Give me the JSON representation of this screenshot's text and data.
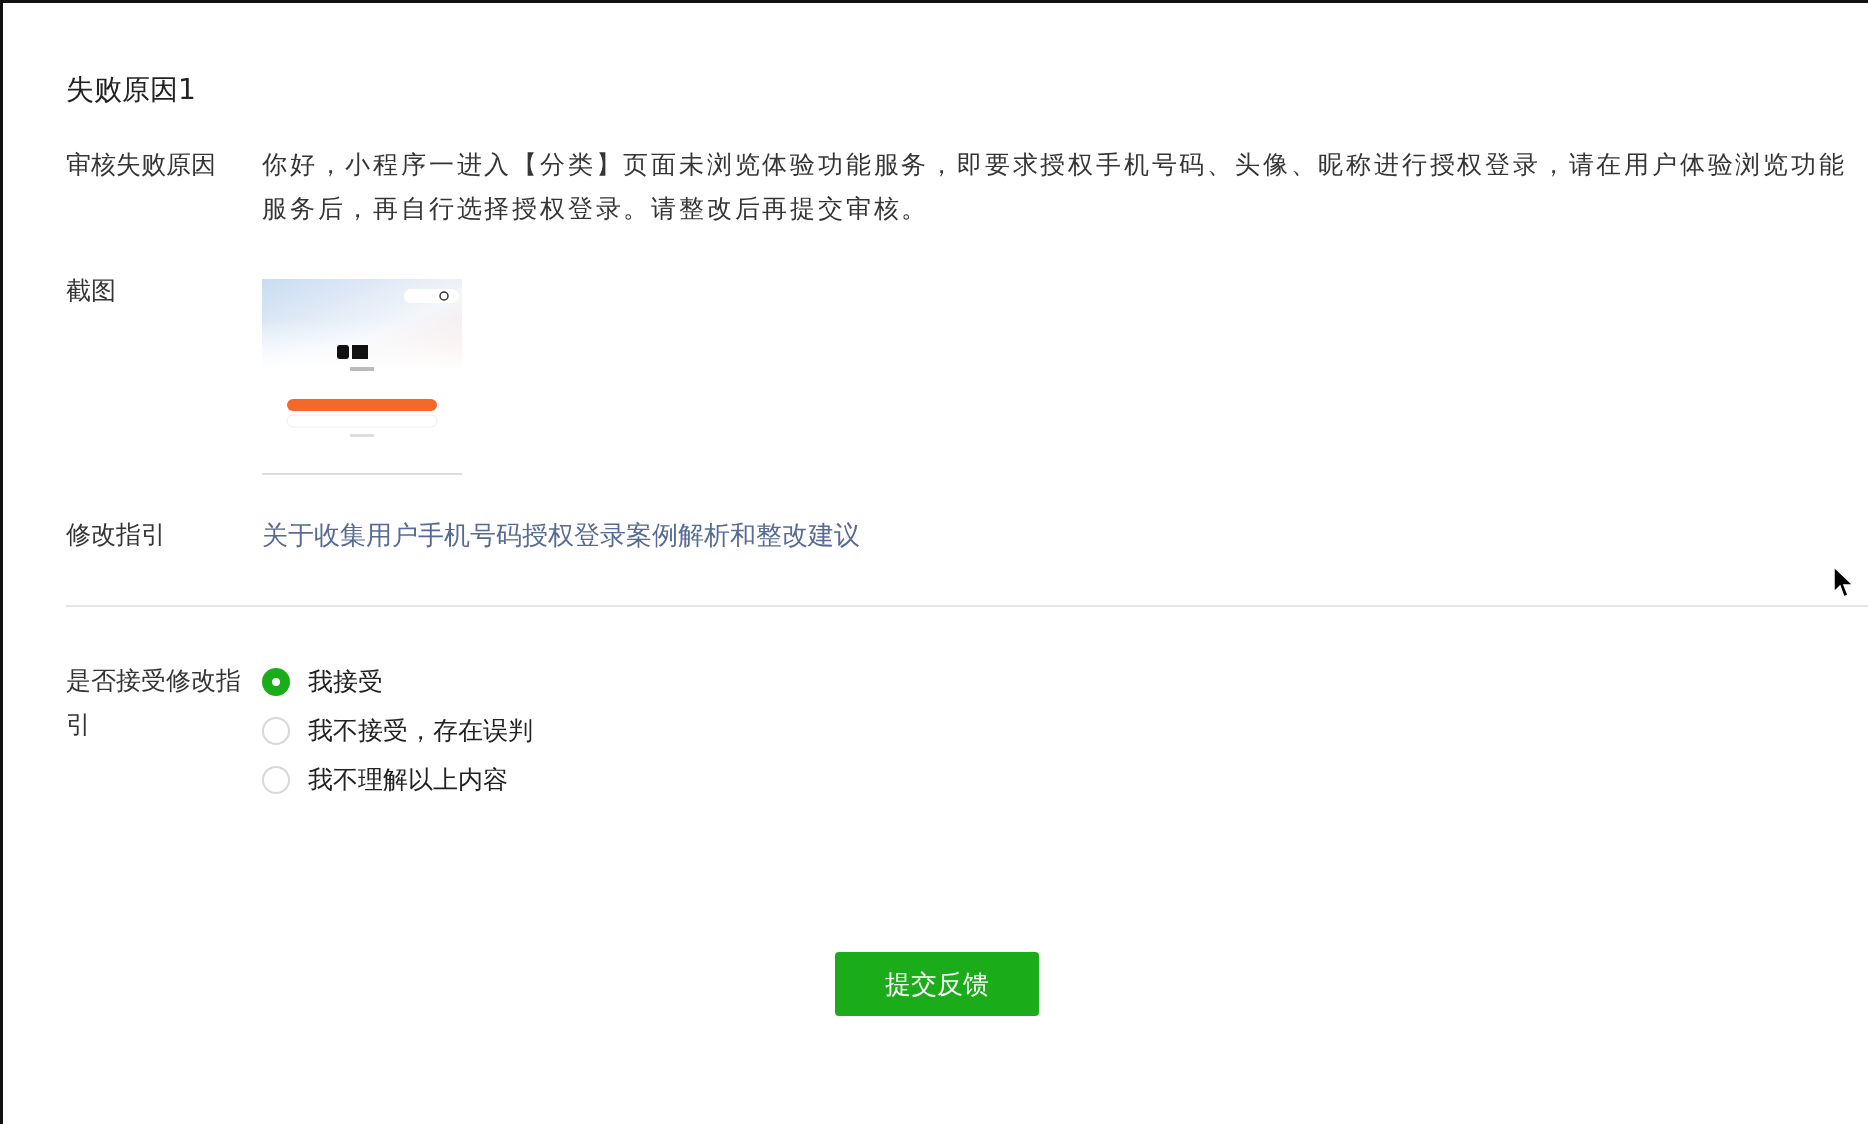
{
  "section_title": "失败原因1",
  "fields": [
    {
      "label": "审核失败原因",
      "kind": "text",
      "value": "你好，小程序一进入【分类】页面未浏览体验功能服务，即要求授权手机号码、头像、昵称进行授权登录，请在用户体验浏览功能服务后，再自行选择授权登录。请整改后再提交审核。"
    },
    {
      "label": "截图",
      "kind": "picture"
    },
    {
      "label": "修改指引",
      "kind": "link",
      "value": "关于收集用户手机号码授权登录案例解析和整改建议"
    }
  ],
  "feedback": {
    "label": "是否接受修改指引",
    "options": [
      {
        "label": "我接受",
        "selected": true
      },
      {
        "label": "我不接受，存在误判",
        "selected": false
      },
      {
        "label": "我不理解以上内容",
        "selected": false
      }
    ]
  },
  "submit_button": "提交反馈"
}
